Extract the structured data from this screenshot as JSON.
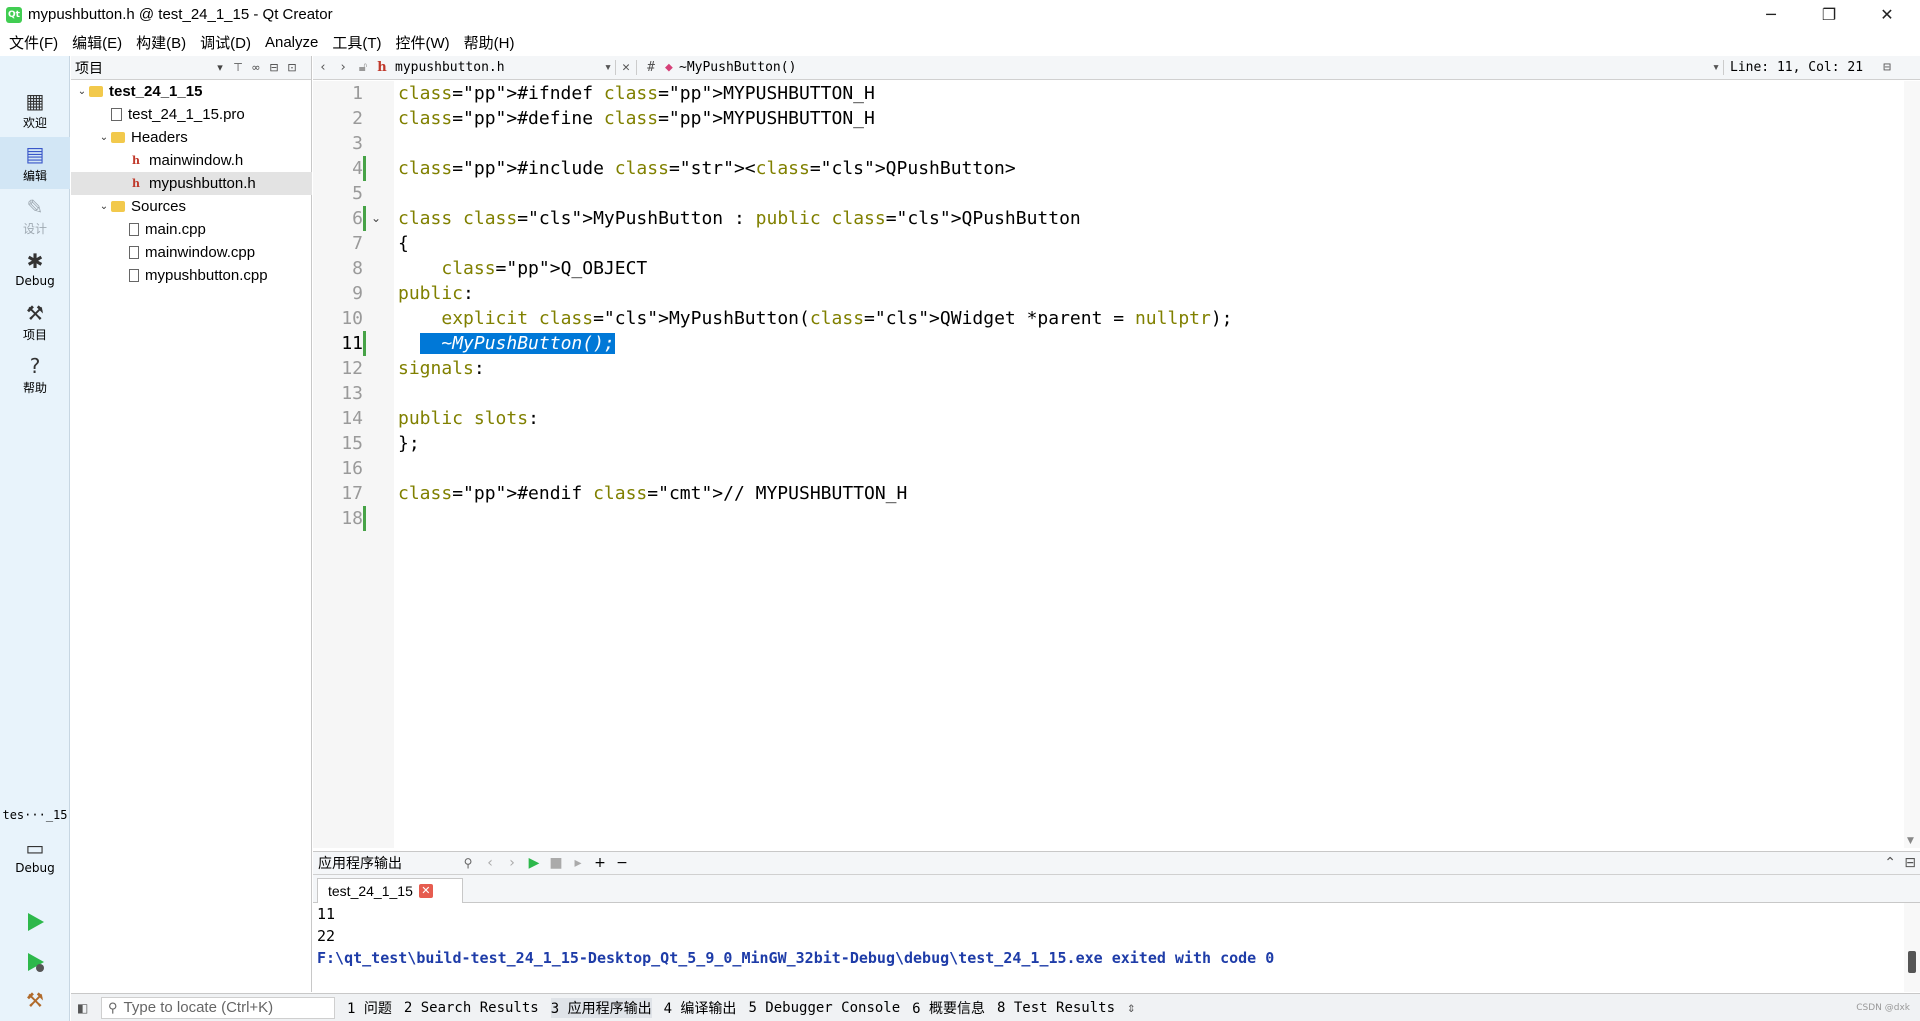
{
  "window": {
    "title": "mypushbutton.h @ test_24_1_15 - Qt Creator",
    "minimize": "─",
    "maximize": "❐",
    "close": "✕"
  },
  "menu": [
    "文件(F)",
    "编辑(E)",
    "构建(B)",
    "调试(D)",
    "Analyze",
    "工具(T)",
    "控件(W)",
    "帮助(H)"
  ],
  "modes": {
    "welcome": "欢迎",
    "edit": "编辑",
    "design": "设计",
    "debug": "Debug",
    "projects": "项目",
    "help": "帮助"
  },
  "kit": {
    "project": "tes···_15",
    "config": "Debug"
  },
  "projects_pane": {
    "title": "项目",
    "tree": [
      {
        "label": "test_24_1_15",
        "level": 0,
        "kind": "project",
        "expanded": true
      },
      {
        "label": "test_24_1_15.pro",
        "level": 1,
        "kind": "pro"
      },
      {
        "label": "Headers",
        "level": 1,
        "kind": "folder",
        "expanded": true
      },
      {
        "label": "mainwindow.h",
        "level": 2,
        "kind": "header"
      },
      {
        "label": "mypushbutton.h",
        "level": 2,
        "kind": "header",
        "selected": true
      },
      {
        "label": "Sources",
        "level": 1,
        "kind": "folder",
        "expanded": true
      },
      {
        "label": "main.cpp",
        "level": 2,
        "kind": "cpp"
      },
      {
        "label": "mainwindow.cpp",
        "level": 2,
        "kind": "cpp"
      },
      {
        "label": "mypushbutton.cpp",
        "level": 2,
        "kind": "cpp"
      }
    ]
  },
  "editor_toolbar": {
    "file": "mypushbutton.h",
    "hash": "#",
    "symbol": "~MyPushButton()",
    "position": "Line: 11, Col: 21"
  },
  "editor": {
    "current_line": 11,
    "lines": [
      {
        "n": "1",
        "text": "#ifndef MYPUSHBUTTON_H"
      },
      {
        "n": "2",
        "text": "#define MYPUSHBUTTON_H"
      },
      {
        "n": "3",
        "text": ""
      },
      {
        "n": "4",
        "text": "#include <QPushButton>"
      },
      {
        "n": "5",
        "text": ""
      },
      {
        "n": "6",
        "text": "class MyPushButton : public QPushButton"
      },
      {
        "n": "7",
        "text": "{"
      },
      {
        "n": "8",
        "text": "    Q_OBJECT"
      },
      {
        "n": "9",
        "text": "public:"
      },
      {
        "n": "10",
        "text": "    explicit MyPushButton(QWidget *parent = nullptr);"
      },
      {
        "n": "11",
        "text": "    ~MyPushButton();"
      },
      {
        "n": "12",
        "text": "signals:"
      },
      {
        "n": "13",
        "text": ""
      },
      {
        "n": "14",
        "text": "public slots:"
      },
      {
        "n": "15",
        "text": "};"
      },
      {
        "n": "16",
        "text": ""
      },
      {
        "n": "17",
        "text": "#endif // MYPUSHBUTTON_H"
      },
      {
        "n": "18",
        "text": ""
      }
    ]
  },
  "output": {
    "title": "应用程序输出",
    "tab": "test_24_1_15",
    "lines": [
      "11",
      "22"
    ],
    "exit_line": "F:\\qt_test\\build-test_24_1_15-Desktop_Qt_5_9_0_MinGW_32bit-Debug\\debug\\test_24_1_15.exe exited with code 0"
  },
  "statusbar": {
    "locator_placeholder": "Type to locate (Ctrl+K)",
    "panes": [
      "1 问题",
      "2 Search Results",
      "3 应用程序输出",
      "4 编译输出",
      "5 Debugger Console",
      "6 概要信息",
      "8 Test Results"
    ],
    "watermark": "CSDN @dxk"
  },
  "colors": {
    "selection": "#0078d7",
    "keyword": "#808000",
    "preprocessor": "#000080",
    "type": "#800080",
    "string": "#008000",
    "change_bar": "#47a347",
    "run_green": "#2db84b"
  },
  "icons": [
    "qt-app-icon",
    "grid-icon",
    "edit-doc-icon",
    "pencil-icon",
    "bug-icon",
    "wrench-icon",
    "help-circle-icon",
    "monitor-icon",
    "run-icon",
    "debug-run-icon",
    "hammer-icon",
    "filter-icon",
    "link-icon",
    "split-icon",
    "close-icon",
    "back-arrow-icon",
    "forward-arrow-icon",
    "lock-icon",
    "search-icon"
  ]
}
